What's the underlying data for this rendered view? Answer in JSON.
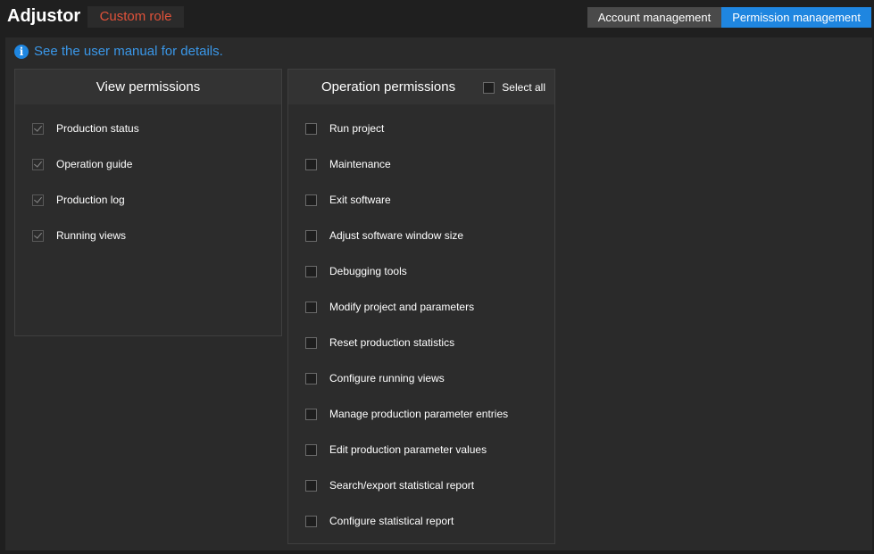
{
  "header": {
    "title": "Adjustor",
    "role_badge": "Custom role",
    "tabs": [
      {
        "label": "Account management",
        "active": false
      },
      {
        "label": "Permission management",
        "active": true
      }
    ]
  },
  "hint": {
    "icon": "info-icon",
    "text": "See the user manual for details."
  },
  "view_permissions": {
    "title": "View permissions",
    "items": [
      {
        "label": "Production status",
        "checked": true
      },
      {
        "label": "Operation guide",
        "checked": true
      },
      {
        "label": "Production log",
        "checked": true
      },
      {
        "label": "Running views",
        "checked": true
      }
    ]
  },
  "operation_permissions": {
    "title": "Operation permissions",
    "select_all_label": "Select all",
    "items": [
      {
        "label": "Run project",
        "checked": false
      },
      {
        "label": "Maintenance",
        "checked": false
      },
      {
        "label": "Exit software",
        "checked": false
      },
      {
        "label": "Adjust software window size",
        "checked": false
      },
      {
        "label": "Debugging tools",
        "checked": false
      },
      {
        "label": "Modify project and parameters",
        "checked": false
      },
      {
        "label": "Reset production statistics",
        "checked": false
      },
      {
        "label": "Configure running views",
        "checked": false
      },
      {
        "label": "Manage production parameter entries",
        "checked": false
      },
      {
        "label": "Edit production parameter values",
        "checked": false
      },
      {
        "label": "Search/export statistical report",
        "checked": false
      },
      {
        "label": "Configure statistical report",
        "checked": false
      }
    ]
  },
  "colors": {
    "accent": "#1f86e0",
    "role_badge_text": "#e0523a",
    "link": "#3a97e8"
  }
}
